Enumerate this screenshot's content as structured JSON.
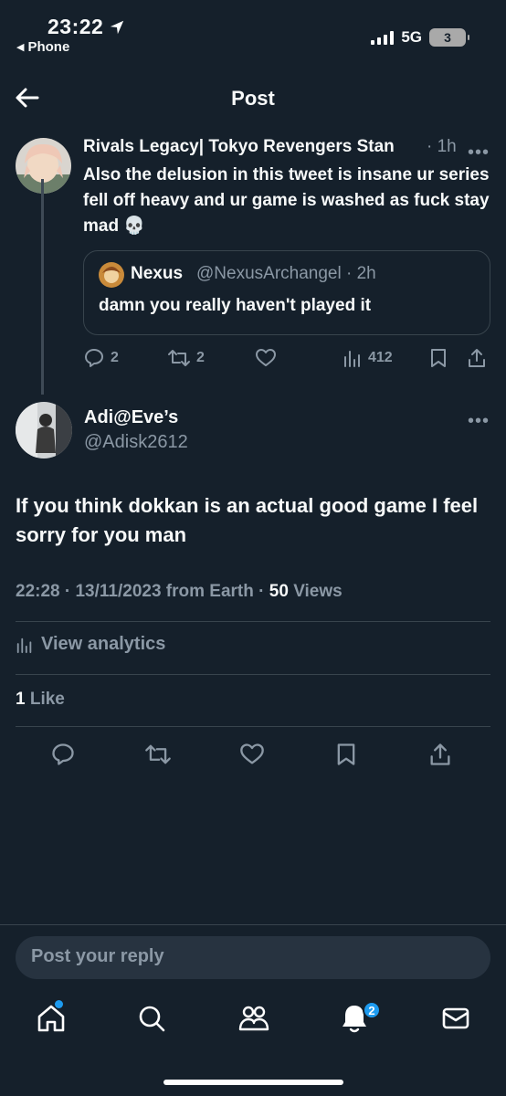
{
  "status_bar": {
    "time": "23:22",
    "back_app": "Phone",
    "network": "5G",
    "battery": "3"
  },
  "header": {
    "title": "Post"
  },
  "parent_post": {
    "display_name": "Rivals Legacy| Tokyo Revengers Stan",
    "time": "· 1h",
    "text": "Also the delusion in this tweet is insane ur series fell off heavy and ur game is washed as fuck stay mad 💀",
    "quote": {
      "display_name": "Nexus",
      "handle_time": "@NexusArchangel · 2h",
      "text": "damn you really haven't played it"
    },
    "actions": {
      "replies": "2",
      "reposts": "2",
      "views": "412"
    }
  },
  "main_post": {
    "display_name": "Adi@Eve’s",
    "handle": "@Adisk2612",
    "text": "If you think dokkan is an actual good game I feel sorry for you man",
    "timestamp": "22:28 · 13/11/2023 from Earth ·",
    "views_count": "50",
    "views_label": "Views",
    "analytics_label": "View analytics",
    "likes_count": "1",
    "likes_label": "Like"
  },
  "reply": {
    "placeholder": "Post your reply"
  },
  "tab_bar": {
    "notifications_badge": "2",
    "tabs": [
      "home-icon",
      "search-icon",
      "communities-icon",
      "notifications-icon",
      "messages-icon"
    ]
  },
  "colors": {
    "background": "#15202b",
    "muted": "#8b98a5",
    "accent": "#1d9bf0",
    "border": "#38444d"
  }
}
